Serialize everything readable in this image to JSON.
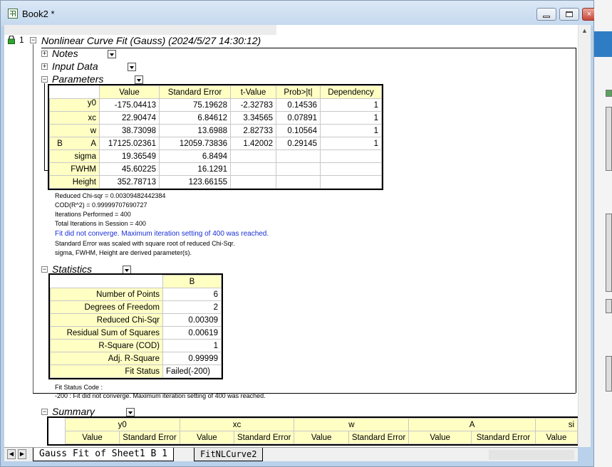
{
  "window": {
    "title": "Book2 *",
    "buttons": {
      "minimize": "minimize-button",
      "maximize": "restore-button",
      "close": "×"
    }
  },
  "report": {
    "row_number": "1",
    "title": "Nonlinear Curve Fit (Gauss) (2024/5/27 14:30:12)",
    "sections": {
      "notes": "Notes",
      "input_data": "Input Data",
      "parameters": "Parameters",
      "statistics": "Statistics",
      "summary": "Summary"
    }
  },
  "parameters": {
    "group": "B",
    "headers": [
      "Value",
      "Standard Error",
      "t-Value",
      "Prob>|t|",
      "Dependency"
    ],
    "rows": [
      {
        "name": "y0",
        "value": "-175.04413",
        "se": "75.19628",
        "t": "-2.32783",
        "p": "0.14536",
        "dep": "1"
      },
      {
        "name": "xc",
        "value": "22.90474",
        "se": "6.84612",
        "t": "3.34565",
        "p": "0.07891",
        "dep": "1"
      },
      {
        "name": "w",
        "value": "38.73098",
        "se": "13.6988",
        "t": "2.82733",
        "p": "0.10564",
        "dep": "1"
      },
      {
        "name": "A",
        "value": "17125.02361",
        "se": "12059.73836",
        "t": "1.42002",
        "p": "0.29145",
        "dep": "1"
      },
      {
        "name": "sigma",
        "value": "19.36549",
        "se": "6.8494",
        "t": "",
        "p": "",
        "dep": ""
      },
      {
        "name": "FWHM",
        "value": "45.60225",
        "se": "16.1291",
        "t": "",
        "p": "",
        "dep": ""
      },
      {
        "name": "Height",
        "value": "352.78713",
        "se": "123.66155",
        "t": "",
        "p": "",
        "dep": ""
      }
    ],
    "notes": [
      "Reduced Chi-sqr = 0.00309482442384",
      "COD(R^2) = 0.99999707690727",
      "Iterations Performed = 400",
      "Total Iterations in Session = 400"
    ],
    "warning": "Fit did not converge. Maximum iteration setting of 400 was reached.",
    "notes2": [
      "Standard Error was scaled with square root of reduced Chi-Sqr.",
      "sigma, FWHM, Height are derived parameter(s)."
    ]
  },
  "statistics": {
    "column": "B",
    "rows": [
      {
        "label": "Number of Points",
        "value": "6"
      },
      {
        "label": "Degrees of Freedom",
        "value": "2"
      },
      {
        "label": "Reduced Chi-Sqr",
        "value": "0.00309"
      },
      {
        "label": "Residual Sum of Squares",
        "value": "0.00619"
      },
      {
        "label": "R-Square (COD)",
        "value": "1"
      },
      {
        "label": "Adj. R-Square",
        "value": "0.99999"
      },
      {
        "label": "Fit Status",
        "value": "Failed(-200)"
      }
    ],
    "status_code_label": "Fit Status Code :",
    "status_code_text": "-200 : Fit did not converge. Maximum iteration setting of 400 was reached."
  },
  "summary": {
    "groups": [
      "y0",
      "xc",
      "w",
      "A",
      "si"
    ],
    "subheaders": [
      "Value",
      "Standard Error",
      "Value",
      "Standard Error",
      "Value",
      "Standard Error",
      "Value",
      "Standard Error",
      "Value"
    ]
  },
  "tabs": {
    "active": "Gauss Fit of Sheet1 B 1",
    "inactive": "FitNLCurve2"
  },
  "colors": {
    "table_header": "#ffffc4",
    "warning_text": "#1a2fd6",
    "title_bar": "#c4d8ee"
  }
}
